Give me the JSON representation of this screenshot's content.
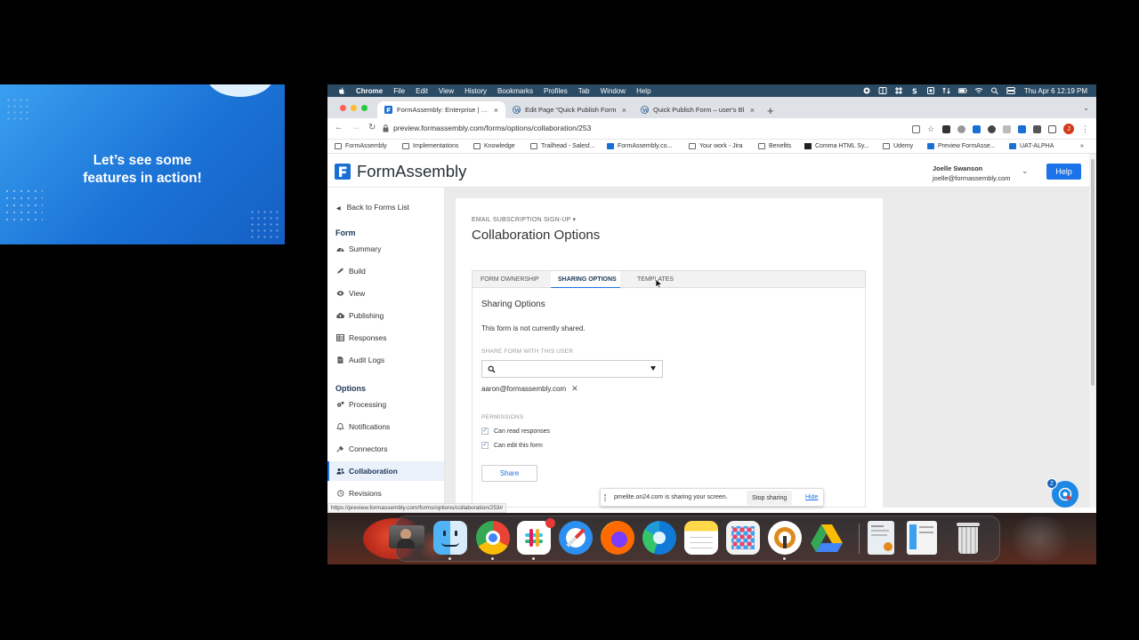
{
  "promo": {
    "headline": "Let’s see some\nfeatures in action!",
    "colors": {
      "gradient_start": "#3aa0f0",
      "gradient_end": "#155fc4"
    }
  },
  "menubar": {
    "app": "Chrome",
    "items": [
      "File",
      "Edit",
      "View",
      "History",
      "Bookmarks",
      "Profiles",
      "Tab",
      "Window",
      "Help"
    ],
    "clock": "Thu Apr 6  12:19 PM",
    "icons": [
      "camera-icon",
      "grid-icon",
      "slack-icon",
      "s-icon",
      "square-icon",
      "sync-icon",
      "battery-icon",
      "wifi-icon",
      "search-icon",
      "control-center-icon"
    ]
  },
  "browser": {
    "tabs": [
      {
        "title": "FormAssembly: Enterprise | For",
        "icon": "formassembly-favicon",
        "active": true
      },
      {
        "title": "Edit Page “Quick Publish Form",
        "icon": "wordpress-favicon",
        "active": false
      },
      {
        "title": "Quick Publish Form – user's Bl",
        "icon": "wordpress-favicon",
        "active": false
      }
    ],
    "new_tab": "+",
    "url": "preview.formassembly.com/forms/options/collaboration/253",
    "bookmarks": [
      {
        "label": "FormAssembly",
        "icon": "folder-icon"
      },
      {
        "label": "Implementations",
        "icon": "folder-icon"
      },
      {
        "label": "Knowledge",
        "icon": "folder-icon"
      },
      {
        "label": "Trailhead - Salesf...",
        "icon": "folder-icon"
      },
      {
        "label": "FormAssembly.co...",
        "icon": "formassembly-favicon"
      },
      {
        "label": "Your work - Jira",
        "icon": "folder-icon"
      },
      {
        "label": "Benefits",
        "icon": "folder-icon"
      },
      {
        "label": "Comma HTML Sy...",
        "icon": "ampersand-icon"
      },
      {
        "label": "Udemy",
        "icon": "folder-icon"
      },
      {
        "label": "Preview FormAsse...",
        "icon": "formassembly-favicon"
      },
      {
        "label": "UAT-ALPHA",
        "icon": "formassembly-favicon"
      }
    ],
    "bookmarks_more": "»",
    "profile_initial": "J",
    "status_url": "https://preview.formassembly.com/forms/options/collaboration/253#"
  },
  "app": {
    "brand": "FormAssembly",
    "user_name": "Joelle Swanson",
    "user_email": "joelle@formassembly.com",
    "help_label": "Help",
    "colors": {
      "primary": "#1a73e8",
      "nav_heading": "#1d3557"
    }
  },
  "sidebar": {
    "back_label": "Back to Forms List",
    "form_heading": "Form",
    "form_items": [
      {
        "label": "Summary",
        "icon": "dashboard-icon"
      },
      {
        "label": "Build",
        "icon": "pencil-icon"
      },
      {
        "label": "View",
        "icon": "eye-icon"
      },
      {
        "label": "Publishing",
        "icon": "cloud-upload-icon"
      },
      {
        "label": "Responses",
        "icon": "table-icon"
      },
      {
        "label": "Audit Logs",
        "icon": "document-icon"
      }
    ],
    "options_heading": "Options",
    "options_items": [
      {
        "label": "Processing",
        "icon": "gears-icon"
      },
      {
        "label": "Notifications",
        "icon": "bell-icon"
      },
      {
        "label": "Connectors",
        "icon": "plug-icon"
      },
      {
        "label": "Collaboration",
        "icon": "users-icon",
        "active": true
      },
      {
        "label": "Revisions",
        "icon": "history-icon"
      }
    ]
  },
  "page": {
    "eyebrow": "EMAIL SUBSCRIPTION SIGN-UP",
    "title": "Collaboration Options",
    "tabs": [
      {
        "label": "FORM OWNERSHIP",
        "active": false
      },
      {
        "label": "SHARING OPTIONS",
        "active": true
      },
      {
        "label": "TEMPLATES",
        "active": false
      }
    ],
    "panel": {
      "heading": "Sharing Options",
      "status_text": "This form is not currently shared.",
      "share_with_label": "SHARE FORM WITH THIS USER",
      "search_value": "",
      "selected_user": "aaron@formassembly.com",
      "remove_symbol": "✕",
      "permissions_label": "PERMISSIONS",
      "permissions": [
        {
          "label": "Can read responses",
          "checked": true
        },
        {
          "label": "Can edit this form",
          "checked": true
        }
      ],
      "share_button": "Share"
    }
  },
  "screen_share": {
    "message": "pmelite.on24.com is sharing your screen.",
    "stop_label": "Stop sharing",
    "hide_label": "Hide"
  },
  "chat_widget": {
    "badge_count": "2"
  },
  "dock": {
    "apps": [
      "photo-booth-icon",
      "finder-icon",
      "chrome-icon",
      "slack-icon",
      "safari-icon",
      "firefox-icon",
      "edge-icon",
      "notes-icon",
      "launchpad-icon",
      "vpn-icon",
      "google-drive-icon",
      "document-thumbnail-icon",
      "document-thumbnail-icon",
      "trash-icon"
    ]
  }
}
